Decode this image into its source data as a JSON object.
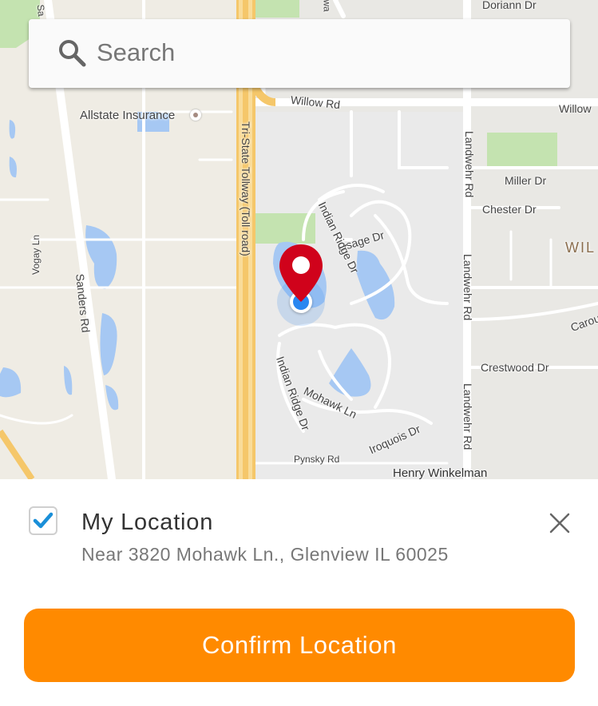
{
  "search": {
    "placeholder": "Search"
  },
  "map": {
    "labels": {
      "dorian": "Doriann Dr",
      "allstate": "Allstate Insurance",
      "willow_rd": "Willow Rd",
      "willow_right": "Willow",
      "tollway": "Tri-State Tollway (Toll road)",
      "landwehr_top": "Landwehr Rd",
      "landwehr_mid": "Landwehr Rd",
      "landwehr_bottom": "Landwehr Rd",
      "miller": "Miller Dr",
      "chester": "Chester Dr",
      "wil": "WIL",
      "osage": "Osage Dr",
      "indian_ridge_top": "Indian Ridge Dr",
      "indian_ridge_bottom": "Indian Ridge Dr",
      "vogay": "Vogay Ln",
      "sanders": "Sanders Rd",
      "crestwood": "Crestwood Dr",
      "carou": "Carou",
      "mohawk": "Mohawk Ln",
      "iroquois": "Iroquois Dr",
      "pynsky": "Pynsky Rd",
      "henry": "Henry Winkelman",
      "s_top": "Sa",
      "way_top": "wa"
    },
    "pin_icon": "map-pin-icon",
    "current_location_icon": "current-location-dot-icon"
  },
  "location": {
    "checked": true,
    "title": "My Location",
    "address": "Near 3820 Mohawk Ln., Glenview IL 60025"
  },
  "confirm": {
    "label": "Confirm Location"
  },
  "colors": {
    "accent": "#ff8a00",
    "check": "#1a8fd8",
    "pin": "#d0021b",
    "dot": "#2a87f0"
  }
}
